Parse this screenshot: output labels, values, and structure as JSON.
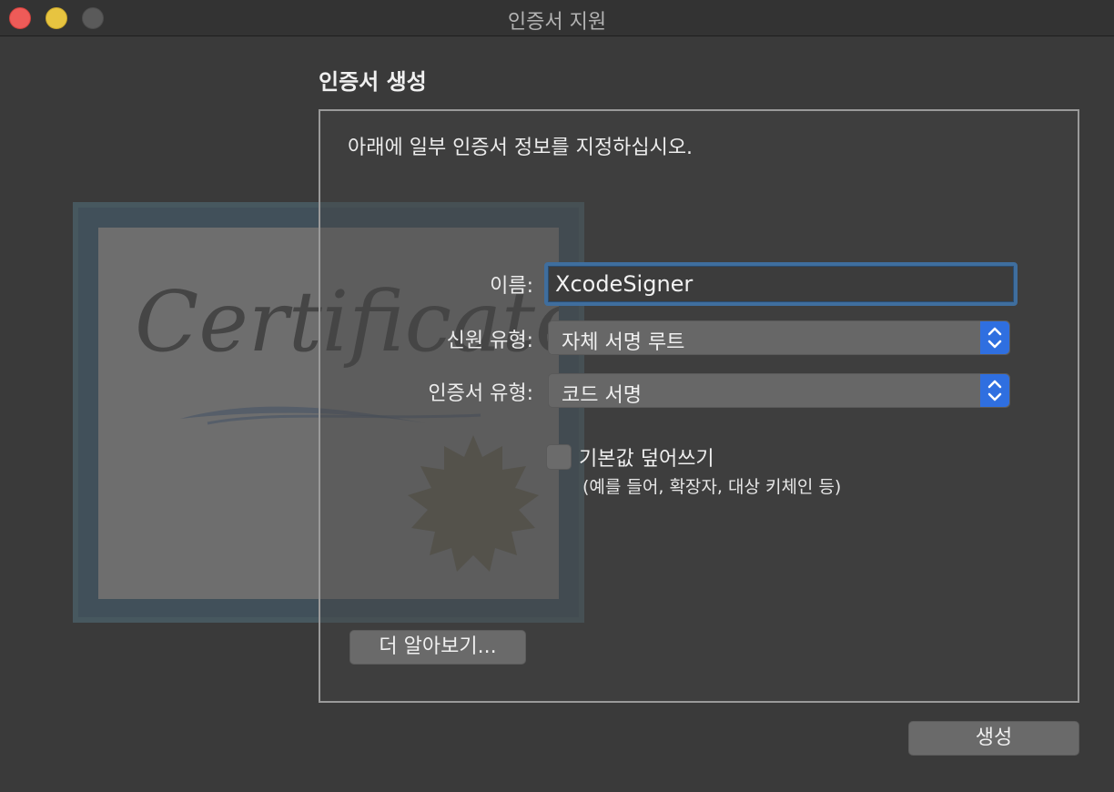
{
  "window": {
    "title": "인증서 지원",
    "controls": [
      "close",
      "minimize",
      "zoom"
    ]
  },
  "section_title": "인증서 생성",
  "instruction": "아래에 일부 인증서 정보를 지정하십시오.",
  "artwork": {
    "certificate_text": "Certificate",
    "icon": "certificate-seal-icon"
  },
  "form": {
    "name": {
      "label": "이름:",
      "value": "XcodeSigner"
    },
    "identity_type": {
      "label": "신원 유형:",
      "value": "자체 서명 루트"
    },
    "certificate_type": {
      "label": "인증서 유형:",
      "value": "코드 서명"
    },
    "override_defaults": {
      "label": "기본값 덮어쓰기",
      "hint": "(예를 들어, 확장자, 대상 키체인 등)",
      "checked": false
    }
  },
  "buttons": {
    "learn_more": "더 알아보기...",
    "create": "생성"
  },
  "colors": {
    "accent": "#2f6fe0",
    "focus_ring": "#3f6e9e",
    "background": "#3a3a3a"
  }
}
